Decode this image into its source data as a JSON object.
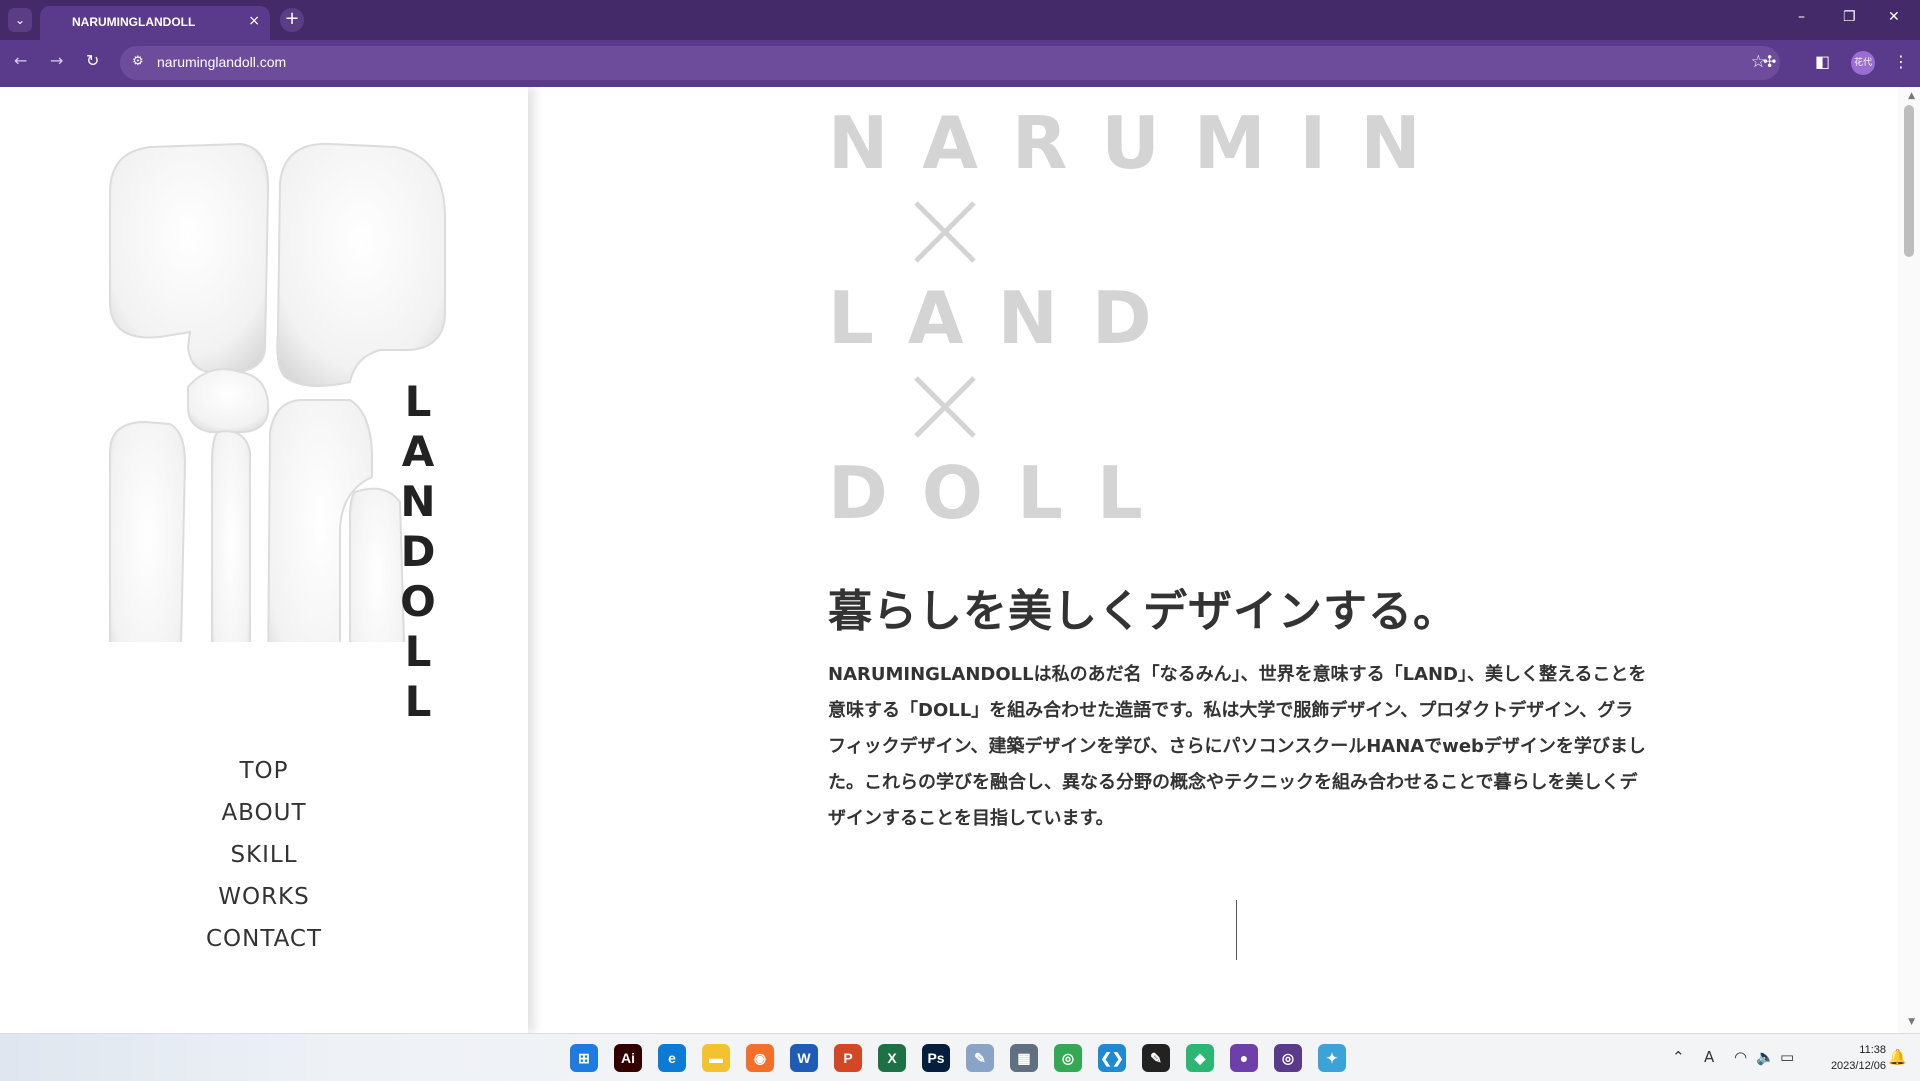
{
  "browser": {
    "tab_title": "NARUMINGLANDOLL",
    "tab_close": "×",
    "new_tab": "+",
    "url": "naruminglandoll.com",
    "profile_label": "花代",
    "window_controls": [
      "–",
      "❐",
      "✕"
    ]
  },
  "sidebar": {
    "logo_letters": [
      "L",
      "A",
      "N",
      "D",
      "O",
      "L",
      "L"
    ],
    "nav": [
      {
        "label": "TOP"
      },
      {
        "label": "ABOUT"
      },
      {
        "label": "SKILL"
      },
      {
        "label": "WORKS"
      },
      {
        "label": "CONTACT"
      }
    ]
  },
  "main": {
    "hero": {
      "word1": "NARUMIN",
      "word2": "LAND",
      "word3": "DOLL"
    },
    "headline": "暮らしを美しくデザインする。",
    "paragraph": "NARUMINGLANDOLLは私のあだ名「なるみん」、世界を意味する「LAND」、美しく整えることを意味する「DOLL」を組み合わせた造語です。私は大学で服飾デザイン、プロダクトデザイン、グラフィックデザイン、建築デザインを学び、さらにパソコンスクールHANAでwebデザインを学びました。これらの学びを融合し、異なる分野の概念やテクニックを組み合わせることで暮らしを美しくデザインすることを目指しています。"
  },
  "taskbar": {
    "apps": [
      {
        "name": "start-icon",
        "glyph": "⊞",
        "color": "#1f7be0"
      },
      {
        "name": "illustrator-icon",
        "glyph": "Ai",
        "color": "#330000"
      },
      {
        "name": "edge-icon",
        "glyph": "e",
        "color": "#0c7bd4"
      },
      {
        "name": "file-explorer-icon",
        "glyph": "▬",
        "color": "#f2c230"
      },
      {
        "name": "firefox-icon",
        "glyph": "◉",
        "color": "#f2702b"
      },
      {
        "name": "word-icon",
        "glyph": "W",
        "color": "#1f5cb8"
      },
      {
        "name": "powerpoint-icon",
        "glyph": "P",
        "color": "#d24726"
      },
      {
        "name": "excel-icon",
        "glyph": "X",
        "color": "#1e7145"
      },
      {
        "name": "photoshop-icon",
        "glyph": "Ps",
        "color": "#061e3d"
      },
      {
        "name": "paint-icon",
        "glyph": "✎",
        "color": "#8aa4c8"
      },
      {
        "name": "calculator-icon",
        "glyph": "▦",
        "color": "#607080"
      },
      {
        "name": "chrome-icon",
        "glyph": "◎",
        "color": "#34a853"
      },
      {
        "name": "vscode-icon",
        "glyph": "❮❯",
        "color": "#1f8ad2"
      },
      {
        "name": "sticky-notes-icon",
        "glyph": "✎",
        "color": "#222222"
      },
      {
        "name": "app-green-icon",
        "glyph": "◆",
        "color": "#2bb673"
      },
      {
        "name": "github-icon",
        "glyph": "●",
        "color": "#6e3fa8"
      },
      {
        "name": "chrome-profile-icon",
        "glyph": "◎",
        "color": "#5a3a8a"
      },
      {
        "name": "app-globe-icon",
        "glyph": "✦",
        "color": "#3ba3d8"
      }
    ],
    "time": "11:38",
    "date": "2023/12/06"
  }
}
